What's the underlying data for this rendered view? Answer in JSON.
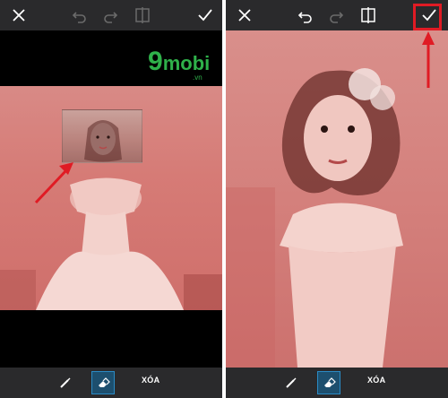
{
  "left_screen": {
    "top_toolbar": {
      "close_icon": "close-icon",
      "undo_icon": "undo-icon",
      "redo_icon": "redo-icon",
      "compare_icon": "compare-icon",
      "apply_icon": "check-icon"
    },
    "watermark": {
      "nine": "9",
      "mobi": "mobi",
      "domain": ".vn"
    },
    "bottom_toolbar": {
      "brush_icon": "brush-icon",
      "eraser_icon": "eraser-icon",
      "clear_label": "XÓA"
    }
  },
  "right_screen": {
    "top_toolbar": {
      "close_icon": "close-icon",
      "undo_icon": "undo-icon",
      "redo_icon": "redo-icon",
      "compare_icon": "compare-icon",
      "apply_icon": "check-icon"
    },
    "bottom_toolbar": {
      "brush_icon": "brush-icon",
      "eraser_icon": "eraser-icon",
      "clear_label": "XÓA"
    }
  },
  "colors": {
    "toolbar_bg": "#2a2a2c",
    "icon_active": "#ffffff",
    "icon_disabled": "#6b6b6b",
    "eraser_active_bg": "#1d4f6e",
    "annotation_red": "#e01b24",
    "watermark_green": "#2fb14a"
  }
}
